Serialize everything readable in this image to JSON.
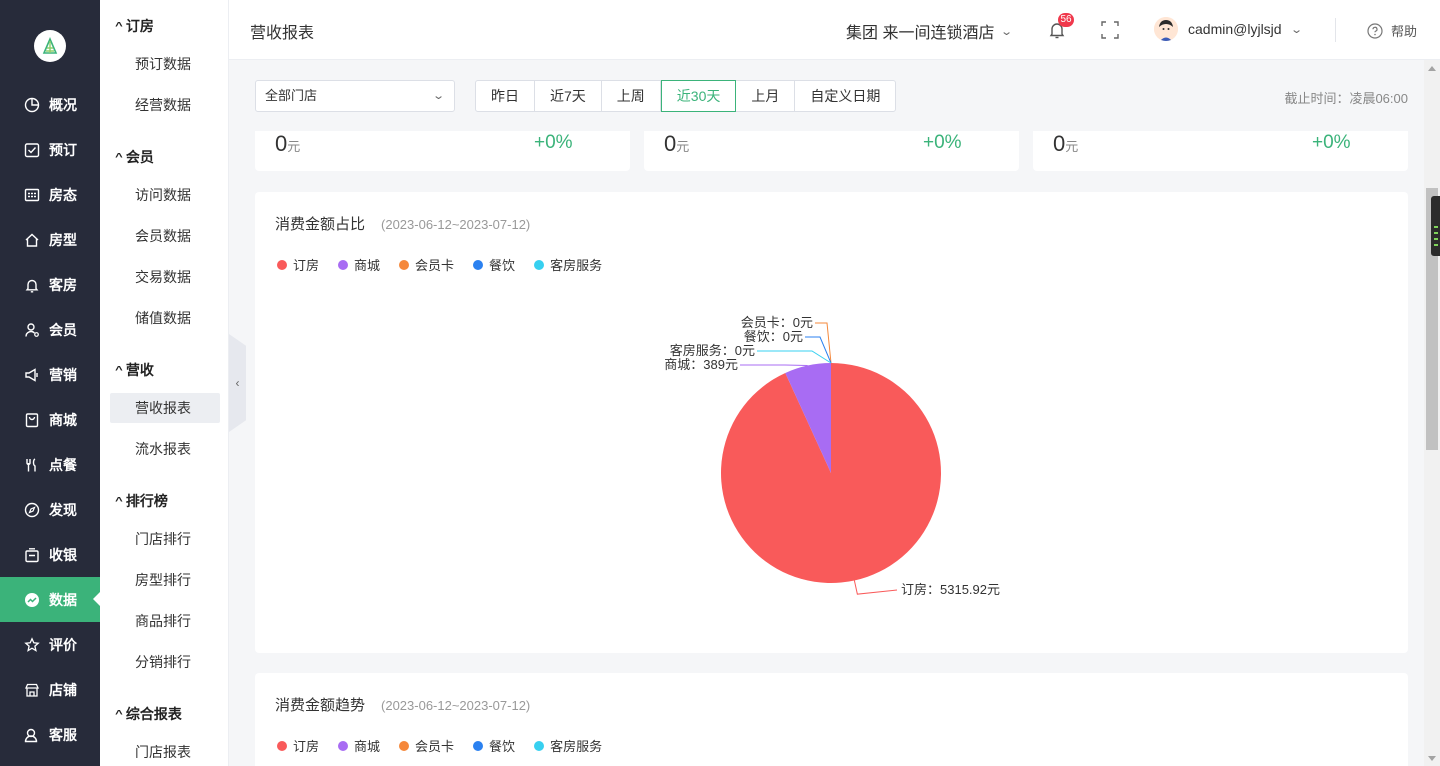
{
  "rail": {
    "items": [
      {
        "label": "概况",
        "icon": "pie-chart-icon"
      },
      {
        "label": "预订",
        "icon": "check-square-icon"
      },
      {
        "label": "房态",
        "icon": "grid-calendar-icon"
      },
      {
        "label": "房型",
        "icon": "home-icon"
      },
      {
        "label": "客房",
        "icon": "bell-icon"
      },
      {
        "label": "会员",
        "icon": "user-icon"
      },
      {
        "label": "营销",
        "icon": "megaphone-icon"
      },
      {
        "label": "商城",
        "icon": "shopping-bag-icon"
      },
      {
        "label": "点餐",
        "icon": "cutlery-icon"
      },
      {
        "label": "发现",
        "icon": "compass-icon"
      },
      {
        "label": "收银",
        "icon": "cash-register-icon"
      },
      {
        "label": "数据",
        "icon": "trend-chart-icon"
      },
      {
        "label": "评价",
        "icon": "star-icon"
      },
      {
        "label": "店铺",
        "icon": "shop-icon"
      },
      {
        "label": "客服",
        "icon": "headset-icon"
      }
    ],
    "active_index": 11
  },
  "subnav": {
    "groups": [
      {
        "title": "订房",
        "items": [
          "预订数据",
          "经营数据"
        ]
      },
      {
        "title": "会员",
        "items": [
          "访问数据",
          "会员数据",
          "交易数据",
          "储值数据"
        ]
      },
      {
        "title": "营收",
        "items": [
          "营收报表",
          "流水报表"
        ]
      },
      {
        "title": "排行榜",
        "items": [
          "门店排行",
          "房型排行",
          "商品排行",
          "分销排行"
        ]
      },
      {
        "title": "综合报表",
        "items": [
          "门店报表"
        ]
      }
    ],
    "active_item": "营收报表"
  },
  "header": {
    "page_title": "营收报表",
    "hotel": "集团 来一间连锁酒店",
    "notification_count": "56",
    "user": "cadmin@lyjlsjd",
    "help": "帮助"
  },
  "filters": {
    "store": "全部门店",
    "ranges": [
      "昨日",
      "近7天",
      "上周",
      "近30天",
      "上月",
      "自定义日期"
    ],
    "active_range": "近30天",
    "deadline": "截止时间：凌晨06:00"
  },
  "stat_cards": [
    {
      "value": "0",
      "unit": "元",
      "change": "+0%"
    },
    {
      "value": "0",
      "unit": "元",
      "change": "+0%"
    },
    {
      "value": "0",
      "unit": "元",
      "change": "+0%"
    }
  ],
  "pie_card": {
    "title": "消费金额占比",
    "range": "(2023-06-12~2023-07-12)"
  },
  "trend_card": {
    "title": "消费金额趋势",
    "range": "(2023-06-12~2023-07-12)"
  },
  "legend": [
    {
      "name": "订房",
      "color": "#f95a5a"
    },
    {
      "name": "商城",
      "color": "#a86cf3"
    },
    {
      "name": "会员卡",
      "color": "#f5883b"
    },
    {
      "name": "餐饮",
      "color": "#2b81f0"
    },
    {
      "name": "客房服务",
      "color": "#37d0f0"
    }
  ],
  "chart_data": {
    "type": "pie",
    "title": "消费金额占比",
    "categories": [
      "订房",
      "商城",
      "会员卡",
      "餐饮",
      "客房服务"
    ],
    "values": [
      5315.92,
      389,
      0,
      0,
      0
    ],
    "unit": "元",
    "labels": [
      "订房：5315.92元",
      "商城：389元",
      "会员卡：0元",
      "餐饮：0元",
      "客房服务：0元"
    ],
    "colors": [
      "#f95a5a",
      "#a86cf3",
      "#f5883b",
      "#2b81f0",
      "#37d0f0"
    ],
    "legend_position": "top-left"
  }
}
